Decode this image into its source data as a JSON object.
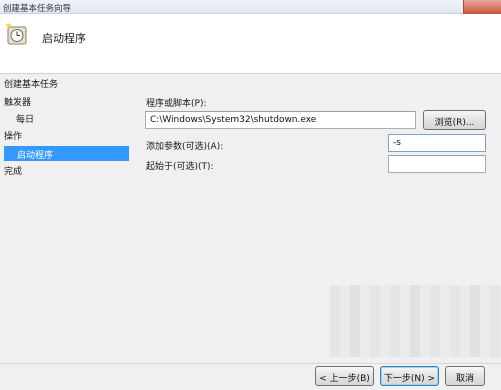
{
  "window": {
    "title": "创建基本任务向导"
  },
  "header": {
    "title": "启动程序",
    "icon": "wizard-clock-icon"
  },
  "sidebar": {
    "items": [
      {
        "label": "创建基本任务",
        "indent": 0,
        "selected": false
      },
      {
        "label": "触发器",
        "indent": 0,
        "selected": false
      },
      {
        "label": "每日",
        "indent": 1,
        "selected": false
      },
      {
        "label": "操作",
        "indent": 0,
        "selected": false
      },
      {
        "label": "启动程序",
        "indent": 1,
        "selected": true
      },
      {
        "label": "完成",
        "indent": 0,
        "selected": false
      }
    ]
  },
  "form": {
    "program_label": "程序或脚本(P):",
    "program_value": "C:\\Windows\\System32\\shutdown.exe",
    "browse_label": "浏览(R)...",
    "args_label": "添加参数(可选)(A):",
    "args_value": "-s",
    "start_in_label": "起始于(可选)(T):",
    "start_in_value": ""
  },
  "footer": {
    "back_label": "< 上一步(B)",
    "next_label": "下一步(N) >",
    "cancel_label": "取消"
  },
  "colors": {
    "selection": "#3399ff",
    "header_bg": "#ffffff",
    "body_bg": "#f0f0f0"
  }
}
